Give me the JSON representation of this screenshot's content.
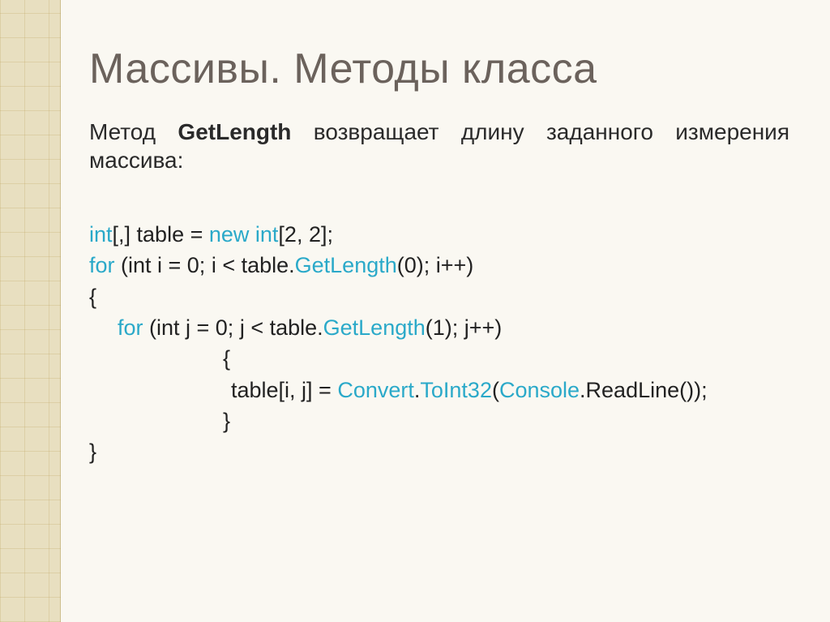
{
  "title": "Массивы. Методы класса",
  "desc": {
    "prefix": "Метод ",
    "method": "GetLength",
    "suffix": " возвращает длину заданного измерения массива:"
  },
  "code": {
    "l1": {
      "a": "int",
      "b": "[,] table = ",
      "c": "new int",
      "d": "[2, 2];"
    },
    "l2": {
      "a": "for",
      "b": " (int i = 0; i < table.",
      "c": "GetLength",
      "d": "(0); i++)"
    },
    "l3": "{",
    "l4": {
      "a": "for",
      "b": " (int j = 0; j < table.",
      "c": "GetLength",
      "d": "(1); j++)"
    },
    "l5": "{",
    "l6": {
      "a": "table[i, j] = ",
      "b": "Convert",
      "c": ".",
      "d": "ToInt32",
      "e": "(",
      "f": "Console",
      "g": ".ReadLine());"
    },
    "l7": "}",
    "l8": "}"
  }
}
